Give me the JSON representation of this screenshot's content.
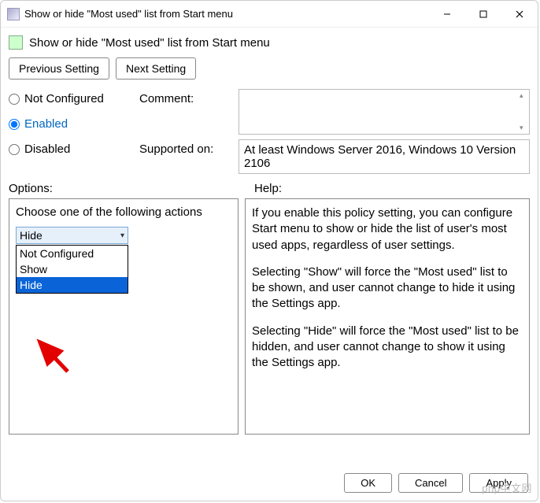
{
  "window": {
    "title": "Show or hide \"Most used\" list from Start menu"
  },
  "header": {
    "title": "Show or hide \"Most used\" list from Start menu"
  },
  "nav": {
    "prev": "Previous Setting",
    "next": "Next Setting"
  },
  "radios": {
    "not_configured": "Not Configured",
    "enabled": "Enabled",
    "disabled": "Disabled",
    "selected": "enabled"
  },
  "labels": {
    "comment": "Comment:",
    "supported": "Supported on:",
    "options": "Options:",
    "help": "Help:"
  },
  "comment": "",
  "supported": "At least Windows Server 2016, Windows 10 Version 2106",
  "options": {
    "prompt": "Choose one of the following actions",
    "selected": "Hide",
    "items": [
      "Not Configured",
      "Show",
      "Hide"
    ]
  },
  "help": {
    "p1": "If you enable this policy setting, you can configure Start menu to show or hide the list of user's most used apps, regardless of user settings.",
    "p2": "Selecting \"Show\" will force the \"Most used\" list to be shown, and user cannot change to hide it using the Settings app.",
    "p3": "Selecting \"Hide\" will force the \"Most used\" list to be hidden, and user cannot change to show it using the Settings app."
  },
  "footer": {
    "ok": "OK",
    "cancel": "Cancel",
    "apply": "Apply"
  },
  "watermark": "php中文网"
}
